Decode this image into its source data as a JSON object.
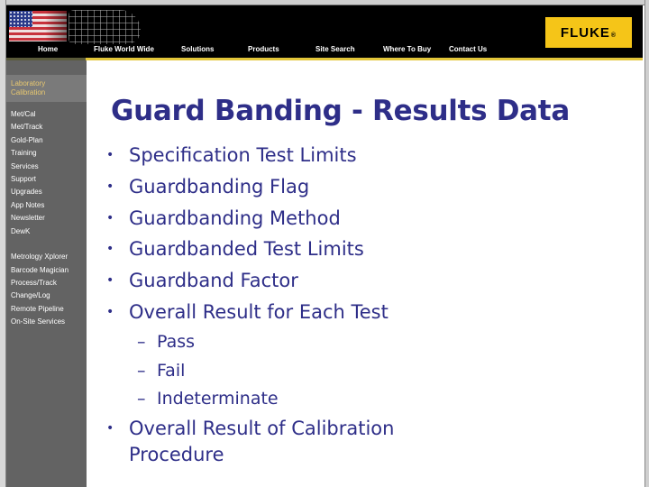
{
  "header": {
    "flag_icon": "us-flag-icon",
    "globe_icon": "world-map-globe-icon",
    "logo_text": "FLUKE",
    "logo_mark": "®",
    "nav": [
      {
        "label": "Home"
      },
      {
        "label": "Fluke World Wide"
      },
      {
        "label": "Solutions"
      },
      {
        "label": "Products"
      },
      {
        "label": "Site Search"
      },
      {
        "label": "Where To Buy"
      },
      {
        "label": "Contact Us"
      }
    ]
  },
  "sidebar": {
    "section_title_line1": "Laboratory",
    "section_title_line2": "Calibration",
    "items": [
      {
        "label": "Met/Cal"
      },
      {
        "label": "Met/Track"
      },
      {
        "label": "Gold-Plan"
      },
      {
        "label": "Training"
      },
      {
        "label": "Services"
      },
      {
        "label": "Support"
      },
      {
        "label": "Upgrades"
      },
      {
        "label": "App Notes"
      },
      {
        "label": "Newsletter"
      },
      {
        "label": "DewK"
      },
      {
        "label": "Metrology Xplorer"
      },
      {
        "label": "Barcode Magician"
      },
      {
        "label": "Process/Track"
      },
      {
        "label": "Change/Log"
      },
      {
        "label": "Remote Pipeline"
      },
      {
        "label": "On-Site Services"
      }
    ]
  },
  "slide": {
    "title": "Guard Banding - Results Data",
    "bullet_char": "•",
    "dash_char": "–",
    "bullets": [
      "Specification Test Limits",
      "Guardbanding Flag",
      "Guardbanding Method",
      "Guardbanded Test Limits",
      "Guardband Factor",
      "Overall Result for Each Test"
    ],
    "sub_bullets": [
      "Pass",
      "Fail",
      "Indeterminate"
    ],
    "final_bullet_line1": "Overall Result of Calibration",
    "final_bullet_line2": "Procedure"
  },
  "colors": {
    "text_blue": "#2e2e88",
    "logo_yellow": "#f5c518",
    "sidebar_gray": "#636363",
    "sidebar_title": "#e8c870"
  }
}
